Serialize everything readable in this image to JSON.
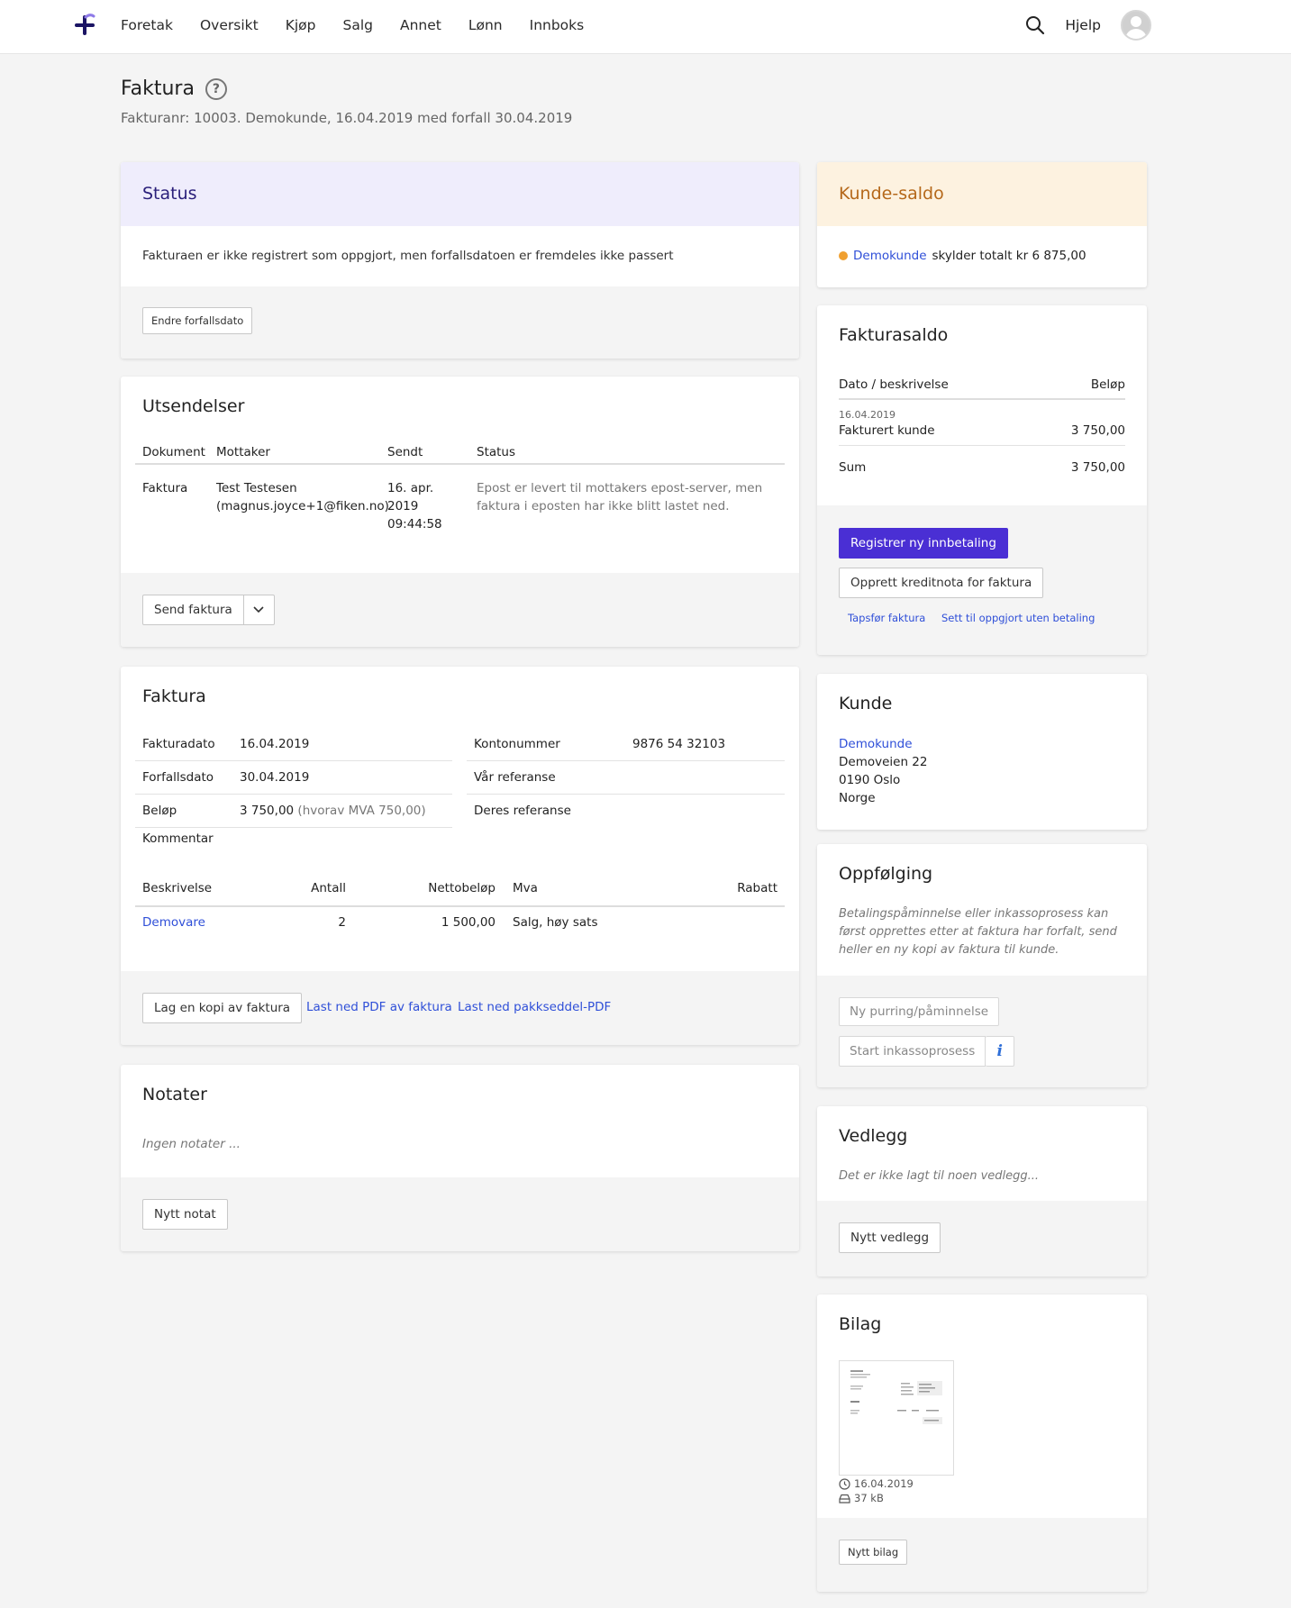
{
  "nav": {
    "items": [
      "Foretak",
      "Oversikt",
      "Kjøp",
      "Salg",
      "Annet",
      "Lønn",
      "Innboks"
    ],
    "help": "Hjelp"
  },
  "page": {
    "title": "Faktura",
    "subtitle": "Fakturanr: 10003. Demokunde, 16.04.2019 med forfall 30.04.2019",
    "help_glyph": "?"
  },
  "status": {
    "title": "Status",
    "text": "Fakturaen er ikke registrert som oppgjort, men forfallsdatoen er fremdeles ikke passert",
    "button": "Endre forfallsdato"
  },
  "utsendelser": {
    "title": "Utsendelser",
    "headers": [
      "Dokument",
      "Mottaker",
      "Sendt",
      "Status"
    ],
    "row": {
      "dokument": "Faktura",
      "mottaker_name": "Test Testesen",
      "mottaker_email": "(magnus.joyce+1@fiken.no)",
      "sendt_1": "16. apr.",
      "sendt_2": "2019",
      "sendt_3": "09:44:58",
      "status_1": "Epost er levert til mottakers epost-server, men",
      "status_2": "faktura i eposten har ikke blitt lastet ned."
    },
    "send_button": "Send faktura"
  },
  "faktura": {
    "title": "Faktura",
    "left": [
      {
        "label": "Fakturadato",
        "value": "16.04.2019"
      },
      {
        "label": "Forfallsdato",
        "value": "30.04.2019"
      },
      {
        "label": "Beløp",
        "value": "3 750,00",
        "extra": "(hvorav MVA 750,00)"
      }
    ],
    "right": [
      {
        "label": "Kontonummer",
        "value": "9876 54 32103"
      },
      {
        "label": "Vår referanse",
        "value": ""
      },
      {
        "label": "Deres referanse",
        "value": ""
      }
    ],
    "comment_label": "Kommentar",
    "lines_headers": [
      "Beskrivelse",
      "Antall",
      "Nettobeløp",
      "Mva",
      "Rabatt"
    ],
    "line": {
      "beskrivelse": "Demovare",
      "antall": "2",
      "netto": "1 500,00",
      "mva": "Salg, høy sats",
      "rabatt": ""
    },
    "copy_button": "Lag en kopi av faktura",
    "pdf_link": "Last ned PDF av faktura",
    "packslip_link": "Last ned pakkseddel-PDF"
  },
  "notater": {
    "title": "Notater",
    "empty": "Ingen notater ...",
    "button": "Nytt notat"
  },
  "kunde_saldo": {
    "title": "Kunde-saldo",
    "customer": "Demokunde",
    "text": "skylder totalt kr 6 875,00",
    "dot_color": "#f0a030",
    "header_bg": "#fdf2e0",
    "title_color": "#b5681a"
  },
  "fakturasaldo": {
    "title": "Fakturasaldo",
    "col1": "Dato / beskrivelse",
    "col2": "Beløp",
    "row_date": "16.04.2019",
    "row_desc": "Fakturert kunde",
    "row_amount": "3 750,00",
    "sum_label": "Sum",
    "sum_amount": "3 750,00",
    "primary_button": "Registrer ny innbetaling",
    "credit_button": "Opprett kreditnota for faktura",
    "link_loss": "Tapsfør faktura",
    "link_settle": "Sett til oppgjort uten betaling"
  },
  "kunde": {
    "title": "Kunde",
    "name": "Demokunde",
    "address1": "Demoveien 22",
    "address2": "0190 Oslo",
    "country": "Norge"
  },
  "oppfolging": {
    "title": "Oppfølging",
    "text1": "Betalingspåminnelse eller inkassoprosess kan",
    "text2": "først opprettes etter at faktura har forfalt, send",
    "text3": "heller en ny kopi av faktura til kunde.",
    "reminder_button": "Ny purring/påminnelse",
    "collection_button": "Start inkassoprosess",
    "info_glyph": "i"
  },
  "vedlegg": {
    "title": "Vedlegg",
    "empty": "Det er ikke lagt til noen vedlegg...",
    "button": "Nytt vedlegg"
  },
  "bilag": {
    "title": "Bilag",
    "date": "16.04.2019",
    "size": "37 kB",
    "button": "Nytt bilag"
  }
}
